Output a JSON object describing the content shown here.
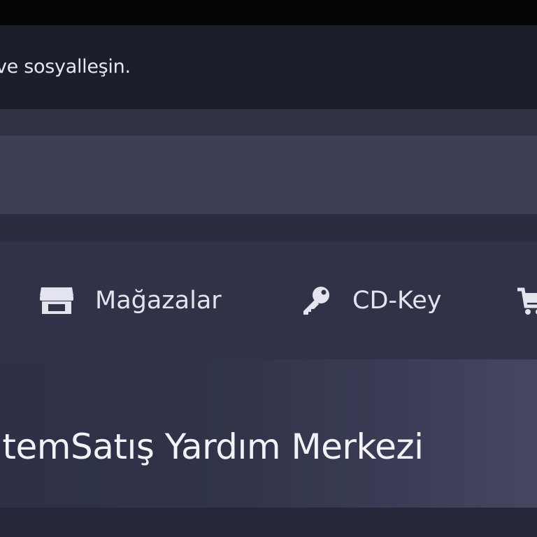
{
  "header": {
    "tagline": "ve sosyalleşin."
  },
  "nav": {
    "items": [
      {
        "label": "Mağazalar",
        "icon": "store-icon"
      },
      {
        "label": "CD-Key",
        "icon": "key-icon"
      },
      {
        "label": "",
        "icon": "cart-icon"
      }
    ]
  },
  "hero": {
    "title": "itemSatış Yardım Merkezi"
  },
  "colors": {
    "background": "#2b2e40",
    "header": "#1c1e2b",
    "text": "#e3e4ee"
  }
}
